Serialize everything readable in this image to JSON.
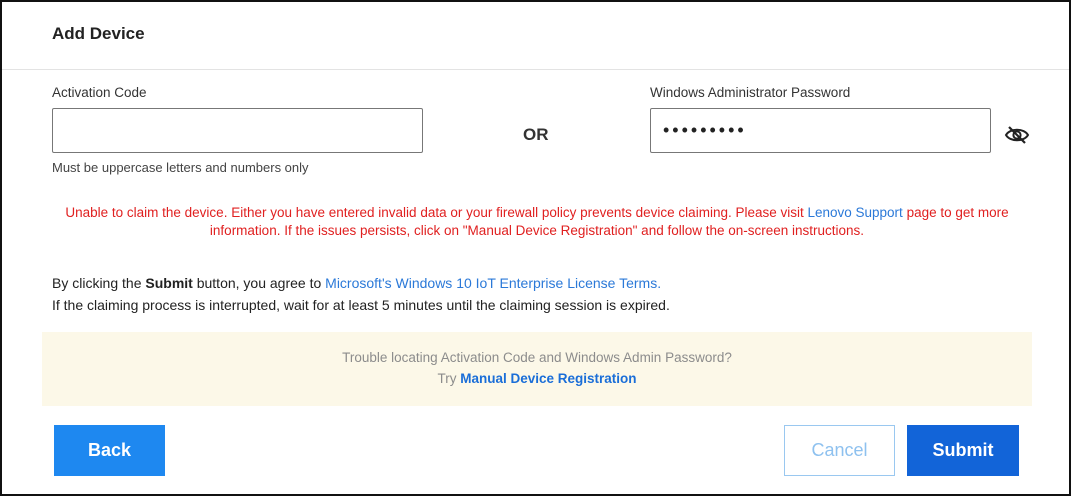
{
  "dialog": {
    "title": "Add Device"
  },
  "activation": {
    "label": "Activation Code",
    "value": "",
    "placeholder": "",
    "hint": "Must be uppercase letters and numbers only"
  },
  "separator": "OR",
  "password": {
    "label": "Windows Administrator Password",
    "value": "•••••••••",
    "toggle_icon": "eye-slash-icon"
  },
  "error": {
    "text_before": "Unable to claim the device. Either you have entered invalid data or your firewall policy prevents device claiming. Please visit ",
    "link": "Lenovo Support",
    "text_after": " page to get more information. If the issues persists, click on \"Manual Device Registration\" and follow the on-screen instructions."
  },
  "terms": {
    "prefix": "By clicking the ",
    "bold": "Submit",
    "middle": " button, you agree to ",
    "link": "Microsoft's Windows 10 IoT Enterprise License Terms.",
    "line2": "If the claiming process is interrupted, wait for at least 5 minutes until the claiming session is expired."
  },
  "trouble": {
    "question": "Trouble locating Activation Code and Windows Admin Password?",
    "try": "Try ",
    "link": "Manual Device Registration"
  },
  "buttons": {
    "back": "Back",
    "cancel": "Cancel",
    "submit": "Submit"
  },
  "colors": {
    "error": "#e02020",
    "link": "#2b79d8",
    "primary": "#1264d8",
    "back": "#1e88f0",
    "notice_bg": "#fcf8e8"
  }
}
